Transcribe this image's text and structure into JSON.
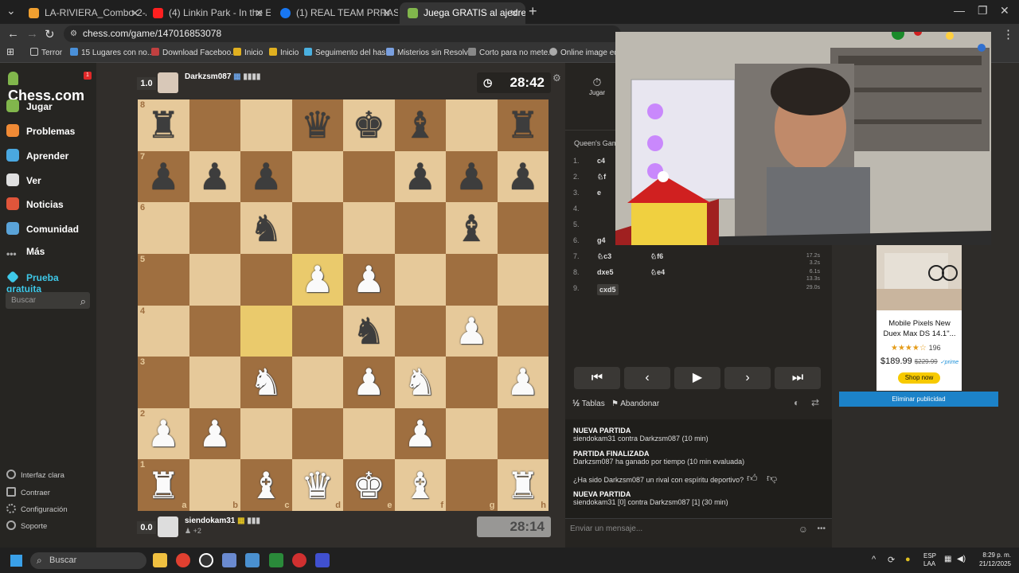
{
  "browser": {
    "tabs": [
      {
        "label": "LA-RIVIERA_Combo-2-Asados-",
        "color": "#f0a030",
        "active": false
      },
      {
        "label": "(4) Linkin Park - In the End",
        "color": "#ff2020",
        "active": false
      },
      {
        "label": "(1) REAL TEAM PRRAS! | Faceb",
        "color": "#1877f2",
        "active": false
      },
      {
        "label": "Juega GRATIS al ajedrez online",
        "color": "#81b64c",
        "active": true
      }
    ],
    "url": "chess.com/game/147016853078",
    "bookmarks": [
      "Terror",
      "15 Lugares con no...",
      "Download Faceboo...",
      "Inicio",
      "Inicio",
      "Seguimento del has...",
      "Misterios sin Resolv...",
      "Corto para no mete...",
      "Online image editor"
    ]
  },
  "sidebar": {
    "logo": "Chess.com",
    "badge": "1",
    "items": [
      {
        "label": "Jugar",
        "color": "#81b64c"
      },
      {
        "label": "Problemas",
        "color": "#f08a35"
      },
      {
        "label": "Aprender",
        "color": "#4aa8e0"
      },
      {
        "label": "Ver",
        "color": "#e0e0e0"
      },
      {
        "label": "Noticias",
        "color": "#e0553a"
      },
      {
        "label": "Comunidad",
        "color": "#5aa3d8"
      },
      {
        "label": "Más",
        "color": "#aaaaaa"
      },
      {
        "label": "Prueba gratuita",
        "color": "#3ec8e8"
      }
    ],
    "search_placeholder": "Buscar",
    "bottom": [
      "Interfaz clara",
      "Contraer",
      "Configuración",
      "Soporte"
    ]
  },
  "top_player": {
    "score": "1.0",
    "name": "Darkzsm087",
    "clock": "28:42"
  },
  "bottom_player": {
    "score": "0.0",
    "name": "siendokam31",
    "extra": "+2",
    "clock": "28:14"
  },
  "board": {
    "ranks": [
      "8",
      "7",
      "6",
      "5",
      "4",
      "3",
      "2",
      "1"
    ],
    "files": [
      "a",
      "b",
      "c",
      "d",
      "e",
      "f",
      "g",
      "h"
    ],
    "rows": [
      [
        "br",
        "",
        "",
        "bq",
        "bk",
        "bb",
        "",
        "br"
      ],
      [
        "bp",
        "bp",
        "bp",
        "",
        "",
        "bp",
        "bp",
        "bp"
      ],
      [
        "",
        "",
        "bn",
        "",
        "",
        "",
        "bb",
        ""
      ],
      [
        "",
        "",
        "",
        "wp",
        "wp",
        "",
        "",
        ""
      ],
      [
        "",
        "",
        "",
        "",
        "bn",
        "",
        "wp",
        ""
      ],
      [
        "",
        "",
        "wn",
        "",
        "wp",
        "wn",
        "",
        "wp"
      ],
      [
        "wp",
        "wp",
        "",
        "",
        "",
        "wp",
        "",
        ""
      ],
      [
        "wr",
        "",
        "wb",
        "wq",
        "wk",
        "wb",
        "",
        "wr"
      ]
    ],
    "highlighted": [
      "d5",
      "c4"
    ]
  },
  "panel": {
    "tab_label": "Jugar",
    "opening": "Queen's Gambit",
    "moves": [
      {
        "n": "1.",
        "w": "c4",
        "b": "",
        "t": ""
      },
      {
        "n": "2.",
        "w": "♘f",
        "b": "",
        "t": ""
      },
      {
        "n": "3.",
        "w": "e",
        "b": "",
        "t": ""
      },
      {
        "n": "4.",
        "w": "",
        "b": "",
        "t": ""
      },
      {
        "n": "5.",
        "w": "",
        "b": "",
        "t": ""
      },
      {
        "n": "6.",
        "w": "g4",
        "b": "",
        "t": ""
      },
      {
        "n": "7.",
        "w": "♘c3",
        "b": "♘f6",
        "t": "17.2s\n3.2s"
      },
      {
        "n": "8.",
        "w": "dxe5",
        "b": "♘e4",
        "t": "6.1s\n13.3s"
      },
      {
        "n": "9.",
        "w": "cxd5",
        "b": "",
        "t": "29.0s"
      }
    ],
    "controls": [
      "⏮",
      "‹",
      "▶",
      "›",
      "⏭"
    ],
    "draw_label": "Tablas",
    "resign_label": "Abandonar",
    "log": [
      {
        "title": "NUEVA PARTIDA",
        "text": "siendokam31 contra Darkzsm087 (10 min)"
      },
      {
        "title": "PARTIDA FINALIZADA",
        "text": "Darkzsm087 ha ganado por tiempo (10 min evaluada)"
      },
      {
        "title": "",
        "text": "¿Ha sido Darkzsm087 un rival con espíritu deportivo?"
      },
      {
        "title": "NUEVA PARTIDA",
        "text": "siendokam31 [0] contra Darkzsm087 [1] (30 min)"
      }
    ],
    "message_placeholder": "Enviar un mensaje..."
  },
  "ad": {
    "title": "Mobile Pixels New Duex Max DS 14.1\"...",
    "rating": "★★★★☆",
    "reviews": "196",
    "price": "$189.99",
    "old_price": "$229.99",
    "prime": "✓prime",
    "shop": "Shop now",
    "remove": "Eliminar publicidad"
  },
  "taskbar": {
    "search": "Buscar",
    "lang": "ESP\nLAA",
    "time": "8:29 p. m.",
    "date": "21/12/2025"
  }
}
